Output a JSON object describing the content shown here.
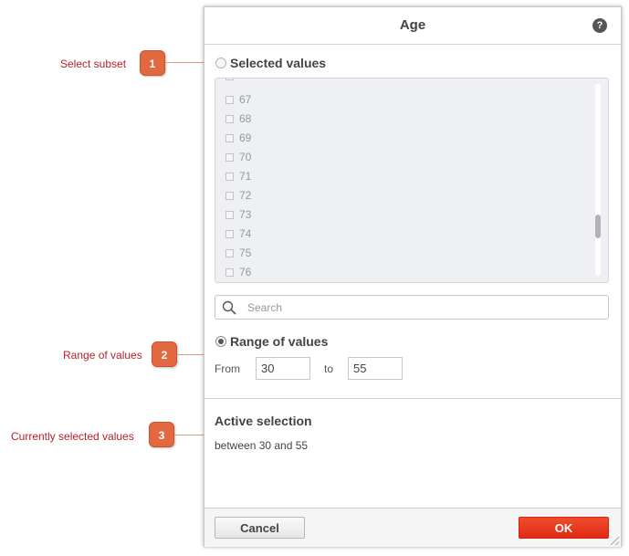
{
  "annotations": [
    {
      "number": "1",
      "label": "Select subset"
    },
    {
      "number": "2",
      "label": "Range of values"
    },
    {
      "number": "3",
      "label": "Currently selected values"
    }
  ],
  "dialog": {
    "title": "Age",
    "help_icon": "?",
    "selected_values": {
      "label": "Selected values",
      "selected": false,
      "items": [
        "67",
        "68",
        "69",
        "70",
        "71",
        "72",
        "73",
        "74",
        "75",
        "76"
      ]
    },
    "search": {
      "placeholder": "Search",
      "value": ""
    },
    "range": {
      "label": "Range of values",
      "selected": true,
      "from_label": "From",
      "from_value": "30",
      "to_label": "to",
      "to_value": "55"
    },
    "active_selection": {
      "title": "Active selection",
      "text": "between 30 and 55"
    },
    "footer": {
      "cancel_label": "Cancel",
      "ok_label": "OK"
    }
  },
  "colors": {
    "callout": "#e2693f",
    "callout_text": "#b8212b",
    "ok_button": "#e8351b"
  }
}
